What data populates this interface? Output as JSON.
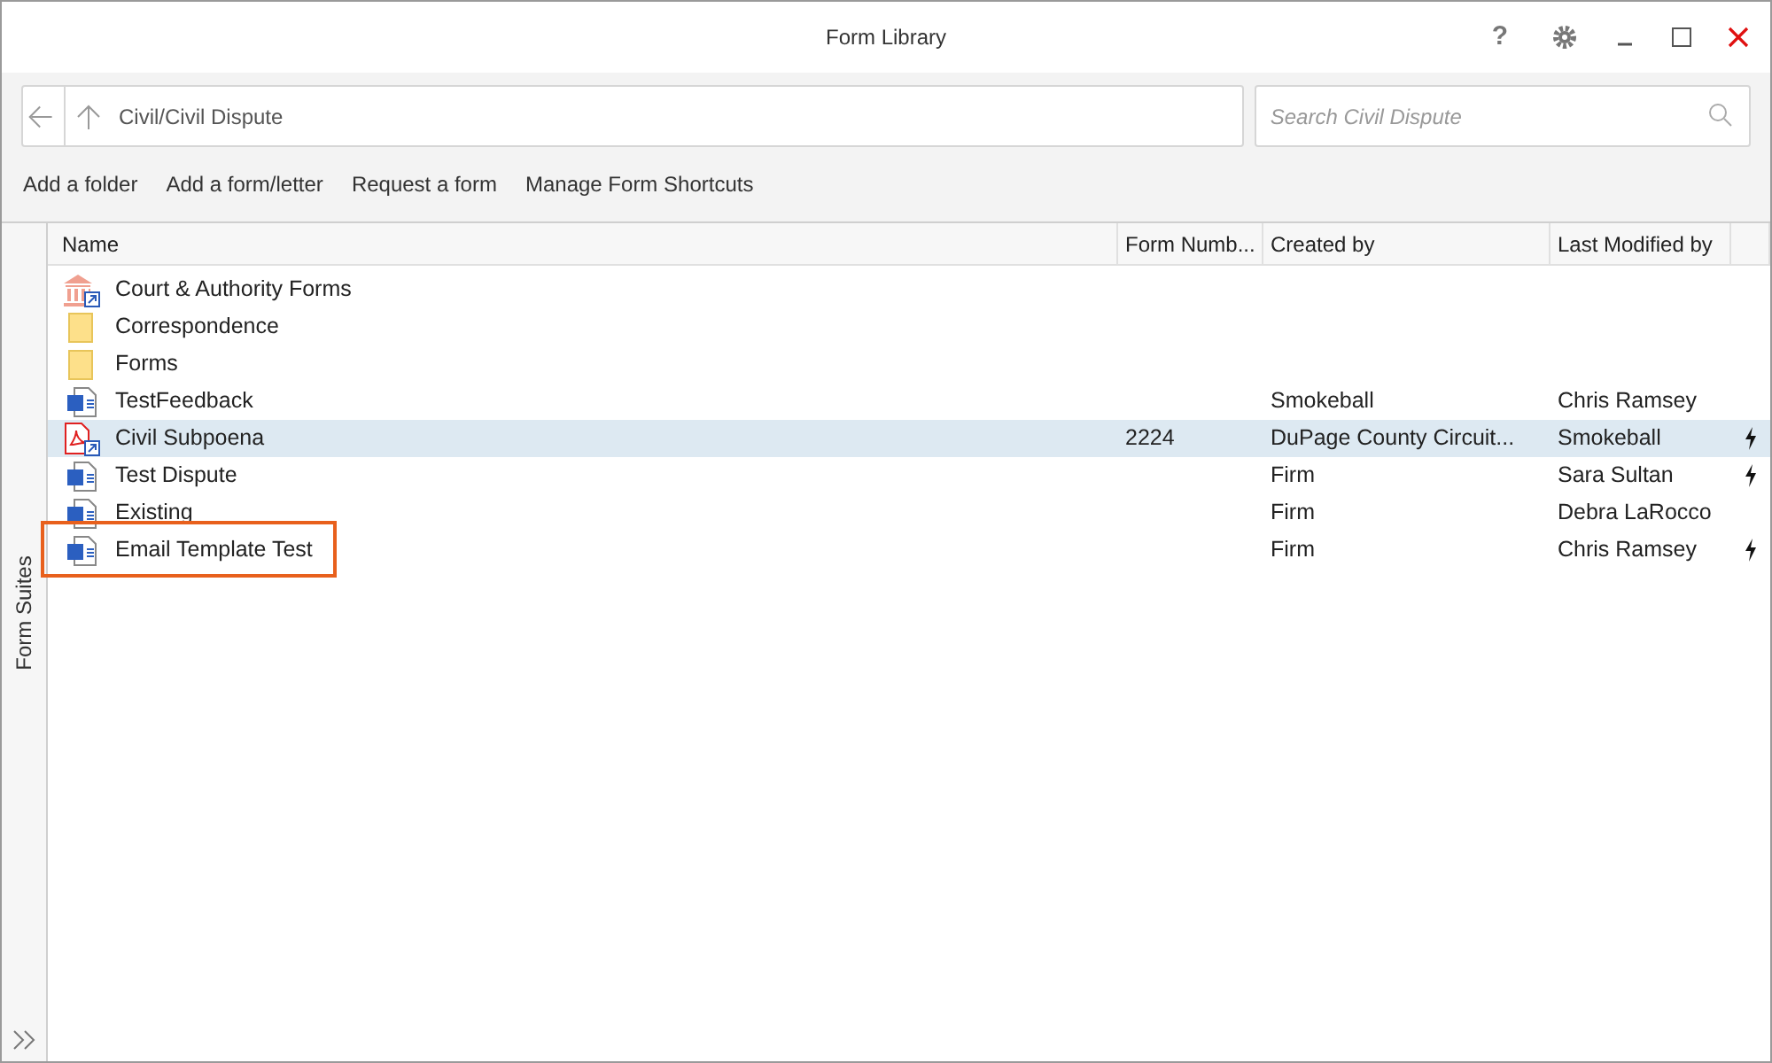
{
  "window": {
    "title": "Form Library",
    "controls": [
      "?"
    ]
  },
  "path": {
    "value": "Civil/Civil Dispute"
  },
  "search": {
    "placeholder": "Search Civil Dispute"
  },
  "actions": [
    "Add a folder",
    "Add a form/letter",
    "Request a form",
    "Manage Form Shortcuts"
  ],
  "sidebar": {
    "label": "Form Suites"
  },
  "table": {
    "columns": [
      "Name",
      "Form Numb...",
      "Created by",
      "Last Modified by"
    ],
    "rows": [
      {
        "kind": "court",
        "name": "Court & Authority Forms",
        "number": "",
        "created": "",
        "modified": "",
        "selected": false,
        "flagged": false,
        "highlighted": false
      },
      {
        "kind": "folder",
        "name": "Correspondence",
        "number": "",
        "created": "",
        "modified": "",
        "selected": false,
        "flagged": false,
        "highlighted": false
      },
      {
        "kind": "folder",
        "name": "Forms",
        "number": "",
        "created": "",
        "modified": "",
        "selected": false,
        "flagged": false,
        "highlighted": false
      },
      {
        "kind": "word",
        "name": "TestFeedback",
        "number": "",
        "created": "Smokeball",
        "modified": "Chris Ramsey",
        "selected": false,
        "flagged": false,
        "highlighted": false
      },
      {
        "kind": "pdf",
        "name": "Civil Subpoena",
        "number": "2224",
        "created": "DuPage County Circuit...",
        "modified": "Smokeball",
        "selected": true,
        "flagged": true,
        "highlighted": false
      },
      {
        "kind": "word",
        "name": "Test Dispute",
        "number": "",
        "created": "Firm",
        "modified": "Sara Sultan",
        "selected": false,
        "flagged": true,
        "highlighted": false
      },
      {
        "kind": "word",
        "name": "Existing",
        "number": "",
        "created": "Firm",
        "modified": "Debra LaRocco",
        "selected": false,
        "flagged": false,
        "highlighted": false
      },
      {
        "kind": "word",
        "name": "Email Template Test",
        "number": "",
        "created": "Firm",
        "modified": "Chris Ramsey",
        "selected": false,
        "flagged": true,
        "highlighted": true
      }
    ]
  }
}
